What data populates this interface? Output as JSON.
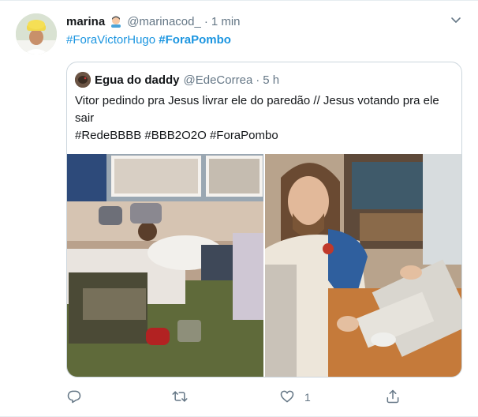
{
  "tweet": {
    "author_name": "marina",
    "author_handle": "@marinacod_",
    "separator": "·",
    "time": "1 min",
    "hashtags": [
      "#ForaVictorHugo",
      "#ForaPombo"
    ]
  },
  "quoted": {
    "author_name": "Egua do daddy",
    "author_handle": "@EdeCorrea",
    "separator": "·",
    "time": "5 h",
    "text": "Vitor pedindo pra Jesus livrar ele do paredão // Jesus votando pra ele sair",
    "hashtags": [
      "#RedeBBBB",
      "#BBB2O2O",
      "#ForaPombo"
    ]
  },
  "actions": {
    "reply_count": "",
    "retweet_count": "",
    "like_count": "1"
  },
  "icons": {
    "menu": "chevron-down-icon",
    "reply": "reply-icon",
    "retweet": "retweet-icon",
    "like": "heart-icon",
    "share": "share-icon"
  },
  "colors": {
    "link": "#1b95e0",
    "secondary_text": "#657786",
    "border": "#ccd6dd"
  }
}
